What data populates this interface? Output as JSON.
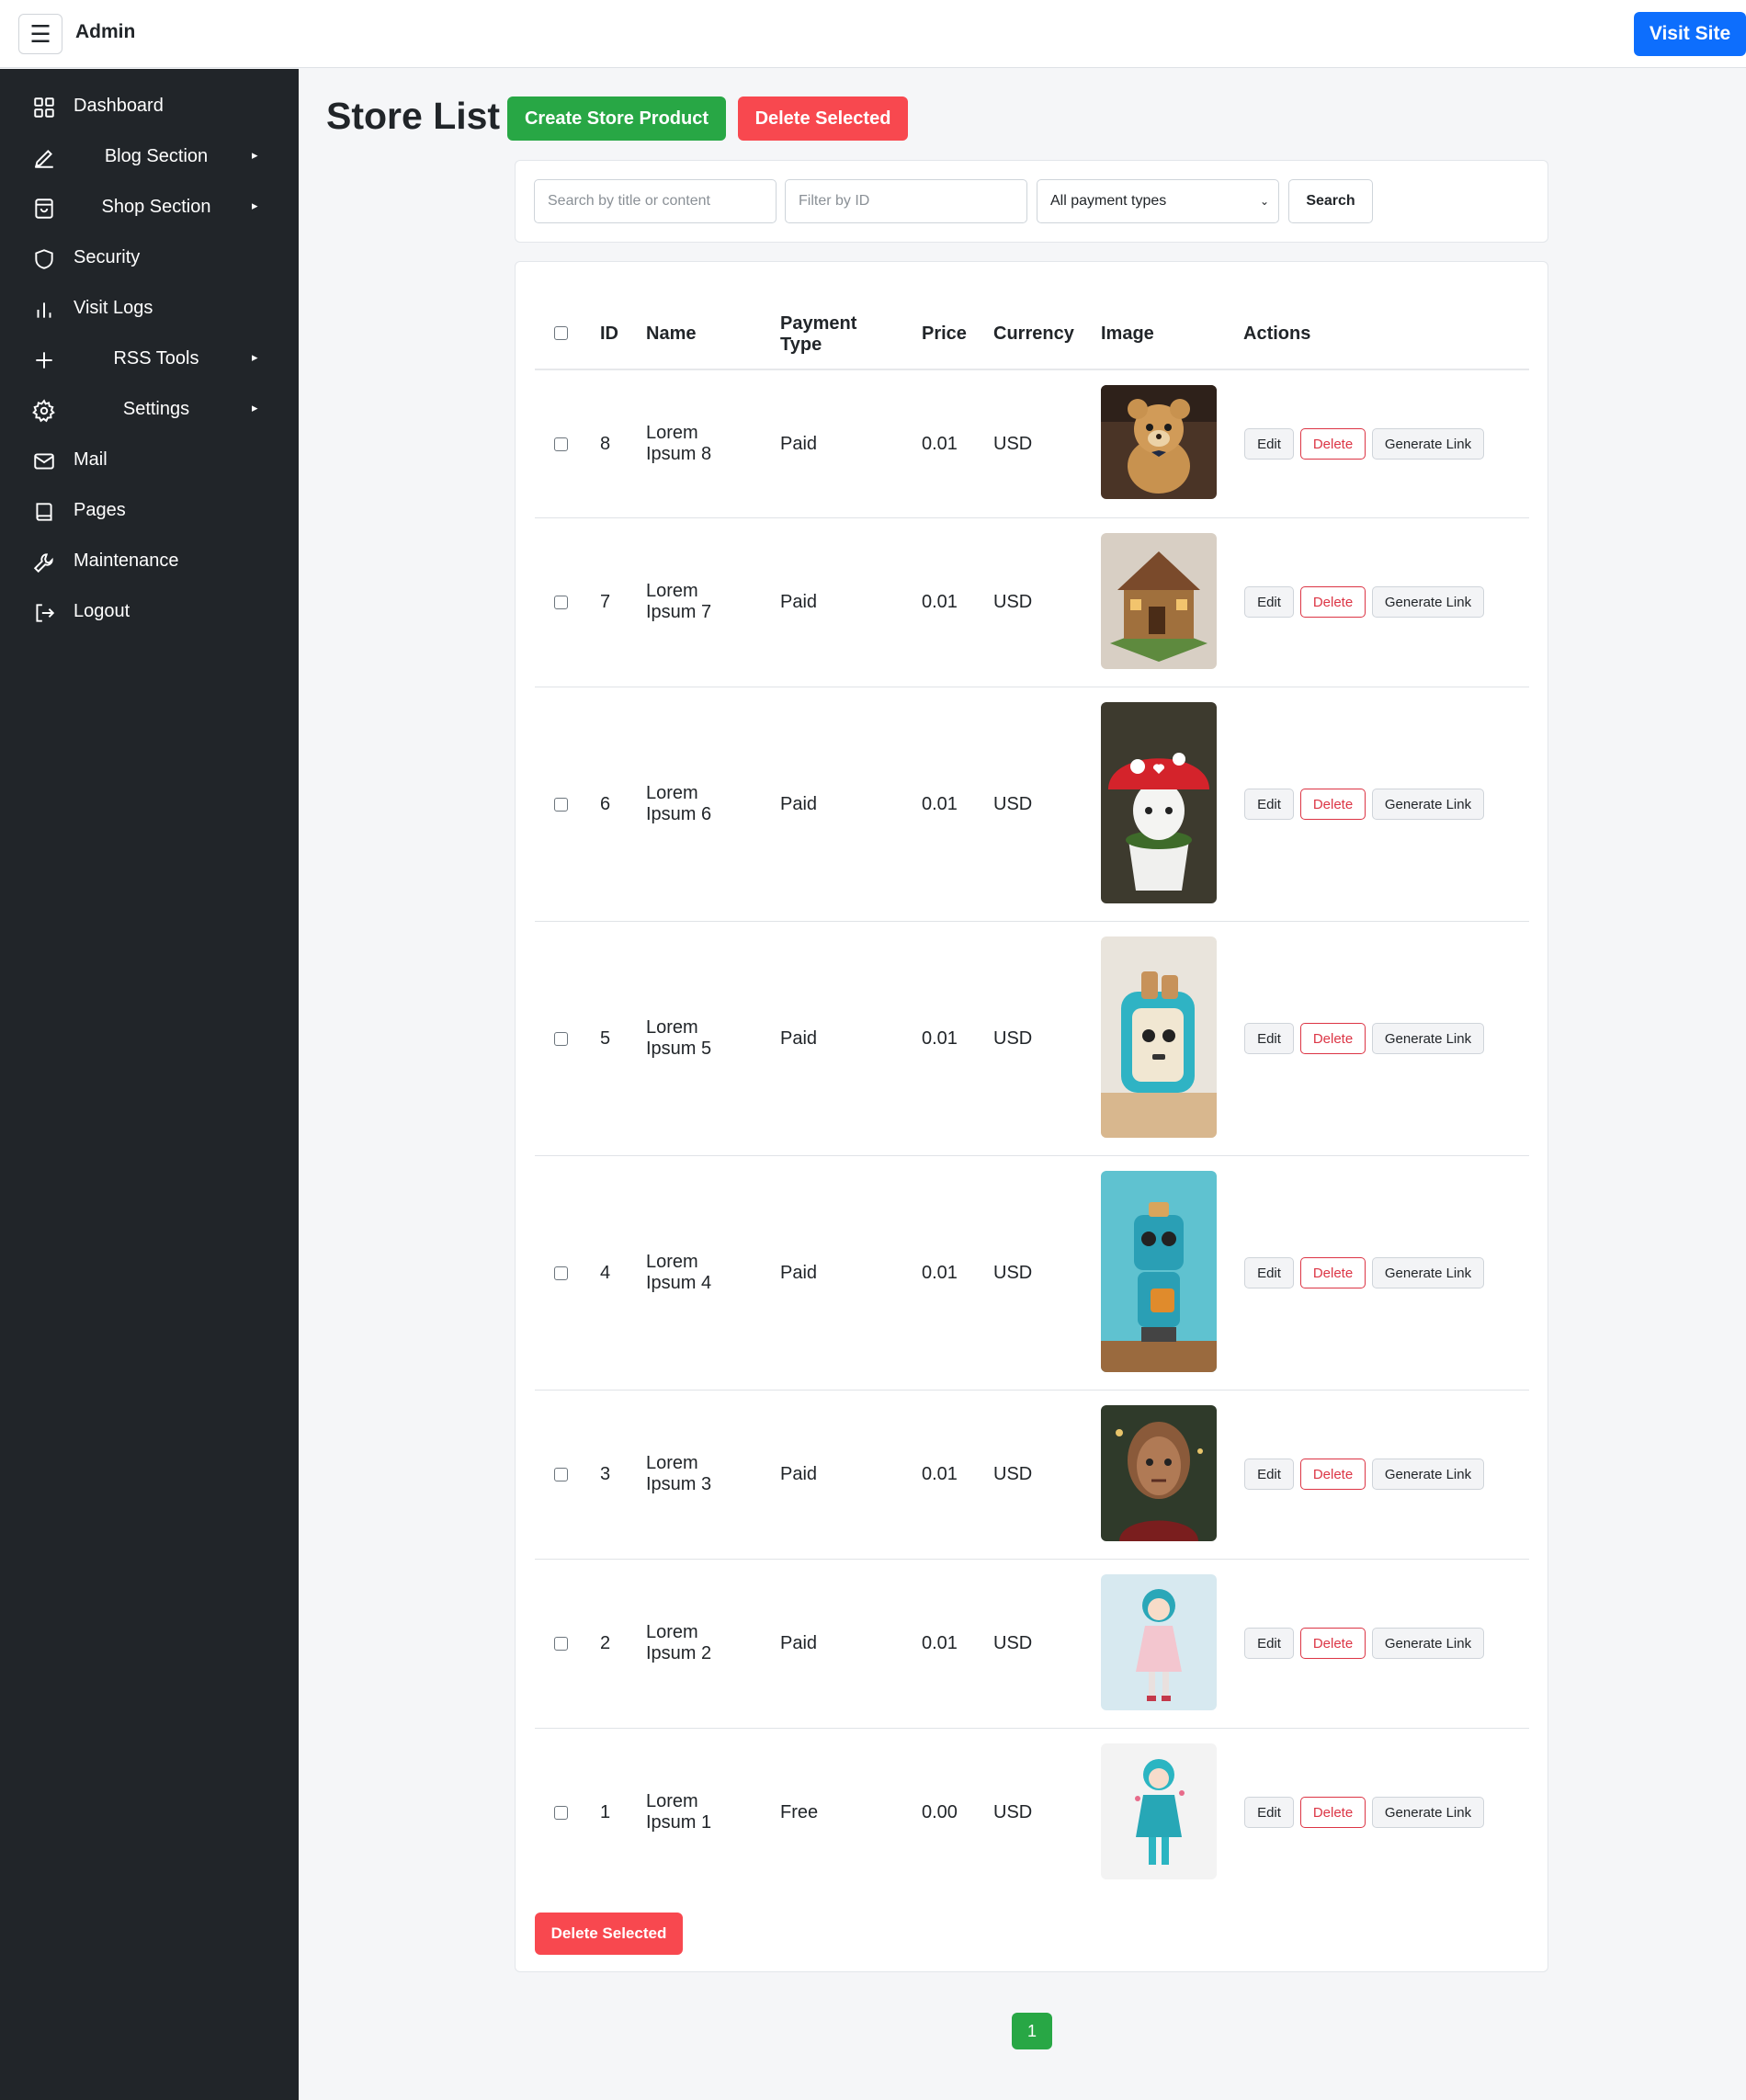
{
  "topbar": {
    "menu_icon": "hamburger-icon",
    "brand": "Admin",
    "visit_site": "Visit Site"
  },
  "sidebar": {
    "items": [
      {
        "label": "Dashboard",
        "icon": "grid-icon"
      },
      {
        "label": "Blog Section",
        "icon": "pen-icon",
        "submenu": true
      },
      {
        "label": "Shop Section",
        "icon": "bag-icon",
        "submenu": true
      },
      {
        "label": "Security",
        "icon": "shield-icon"
      },
      {
        "label": "Visit Logs",
        "icon": "bar-chart-icon"
      },
      {
        "label": "RSS Tools",
        "icon": "plus-icon",
        "submenu": true
      },
      {
        "label": "Settings",
        "icon": "gear-icon",
        "submenu": true
      },
      {
        "label": "Mail",
        "icon": "envelope-icon"
      },
      {
        "label": "Pages",
        "icon": "book-icon"
      },
      {
        "label": "Maintenance",
        "icon": "wrench-icon"
      },
      {
        "label": "Logout",
        "icon": "logout-icon"
      }
    ],
    "submenu_arrow": "▸"
  },
  "main": {
    "title": "Store List",
    "create_button": "Create Store Product",
    "delete_selected_button": "Delete Selected",
    "filters": {
      "search_placeholder": "Search by title or content",
      "id_placeholder": "Filter by ID",
      "payment_select": "All payment types",
      "search_button": "Search"
    },
    "table": {
      "headers": {
        "id": "ID",
        "name": "Name",
        "payment_type_1": "Payment",
        "payment_type_2": "Type",
        "price": "Price",
        "currency": "Currency",
        "image": "Image",
        "actions": "Actions"
      },
      "rows": [
        {
          "id": "8",
          "name_1": "Lorem",
          "name_2": "Ipsum 8",
          "payment": "Paid",
          "price": "0.01",
          "currency": "USD",
          "image": "teddy-bear-image"
        },
        {
          "id": "7",
          "name_1": "Lorem",
          "name_2": "Ipsum 7",
          "payment": "Paid",
          "price": "0.01",
          "currency": "USD",
          "image": "cottage-image"
        },
        {
          "id": "6",
          "name_1": "Lorem",
          "name_2": "Ipsum 6",
          "payment": "Paid",
          "price": "0.01",
          "currency": "USD",
          "image": "mushroom-image"
        },
        {
          "id": "5",
          "name_1": "Lorem",
          "name_2": "Ipsum 5",
          "payment": "Paid",
          "price": "0.01",
          "currency": "USD",
          "image": "toaster-image"
        },
        {
          "id": "4",
          "name_1": "Lorem",
          "name_2": "Ipsum 4",
          "payment": "Paid",
          "price": "0.01",
          "currency": "USD",
          "image": "robot-toaster-image"
        },
        {
          "id": "3",
          "name_1": "Lorem",
          "name_2": "Ipsum 3",
          "payment": "Paid",
          "price": "0.01",
          "currency": "USD",
          "image": "cyborg-portrait-image"
        },
        {
          "id": "2",
          "name_1": "Lorem",
          "name_2": "Ipsum 2",
          "payment": "Paid",
          "price": "0.01",
          "currency": "USD",
          "image": "anime-girl-image"
        },
        {
          "id": "1",
          "name_1": "Lorem",
          "name_2": "Ipsum 1",
          "payment": "Free",
          "price": "0.00",
          "currency": "USD",
          "image": "anime-figure-image"
        }
      ],
      "actions": {
        "edit": "Edit",
        "delete": "Delete",
        "generate_link": "Generate Link"
      }
    },
    "bottom_delete_button": "Delete Selected",
    "pagination": {
      "current_page": "1"
    }
  },
  "colors": {
    "sidebar_bg": "#212529",
    "primary": "#0d6efd",
    "success": "#28a745",
    "danger": "#f8484f"
  }
}
